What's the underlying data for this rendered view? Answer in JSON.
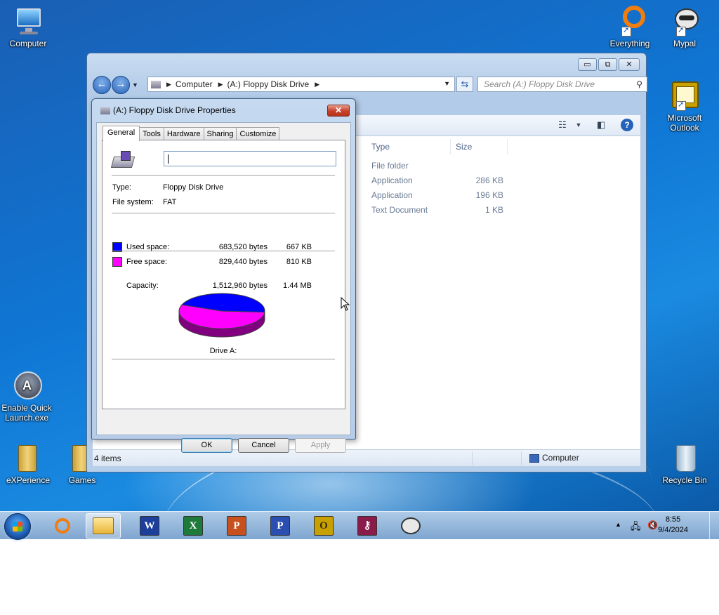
{
  "desktop": {
    "icons": {
      "computer": "Computer",
      "everything": "Everything",
      "mypal": "Mypal",
      "outlook": "Microsoft\nOutlook",
      "quicklaunch": "Enable Quick\nLaunch.exe",
      "experience": "eXPerience",
      "games": "Games",
      "recycle": "Recycle Bin"
    }
  },
  "explorer": {
    "caption_buttons": [
      "▭",
      "⧉",
      "✕"
    ],
    "breadcrumb": [
      "Computer",
      "(A:) Floppy Disk Drive"
    ],
    "search_placeholder": "Search (A:) Floppy Disk Drive",
    "columns": [
      "Type",
      "Size"
    ],
    "rows": [
      {
        "type": "File folder",
        "size": ""
      },
      {
        "type": "Application",
        "size": "286 KB"
      },
      {
        "type": "Application",
        "size": "196 KB"
      },
      {
        "type": "Text Document",
        "size": "1 KB"
      }
    ],
    "status_items": "4 items",
    "status_location": "Computer"
  },
  "dialog": {
    "title": "(A:) Floppy Disk Drive Properties",
    "close": "✕",
    "tabs": [
      "General",
      "Tools",
      "Hardware",
      "Sharing",
      "Customize"
    ],
    "name_value": "",
    "type_label": "Type:",
    "type_value": "Floppy Disk Drive",
    "fs_label": "File system:",
    "fs_value": "FAT",
    "used_label": "Used space:",
    "used_bytes": "683,520 bytes",
    "used_short": "667 KB",
    "free_label": "Free space:",
    "free_bytes": "829,440 bytes",
    "free_short": "810 KB",
    "capacity_label": "Capacity:",
    "capacity_bytes": "1,512,960 bytes",
    "capacity_short": "1.44 MB",
    "drive_label": "Drive A:",
    "ok": "OK",
    "cancel": "Cancel",
    "apply": "Apply",
    "used_fraction": 0.452,
    "colors": {
      "used": "#0000ff",
      "free": "#ff00ff"
    }
  },
  "taskbar": {
    "apps": [
      "Search",
      "Windows Explorer",
      "Microsoft Word",
      "Microsoft Excel",
      "Microsoft PowerPoint",
      "Microsoft Publisher",
      "Microsoft Outlook",
      "Key Manager",
      "Mypal"
    ],
    "time": "8:55",
    "date": "9/4/2024"
  }
}
